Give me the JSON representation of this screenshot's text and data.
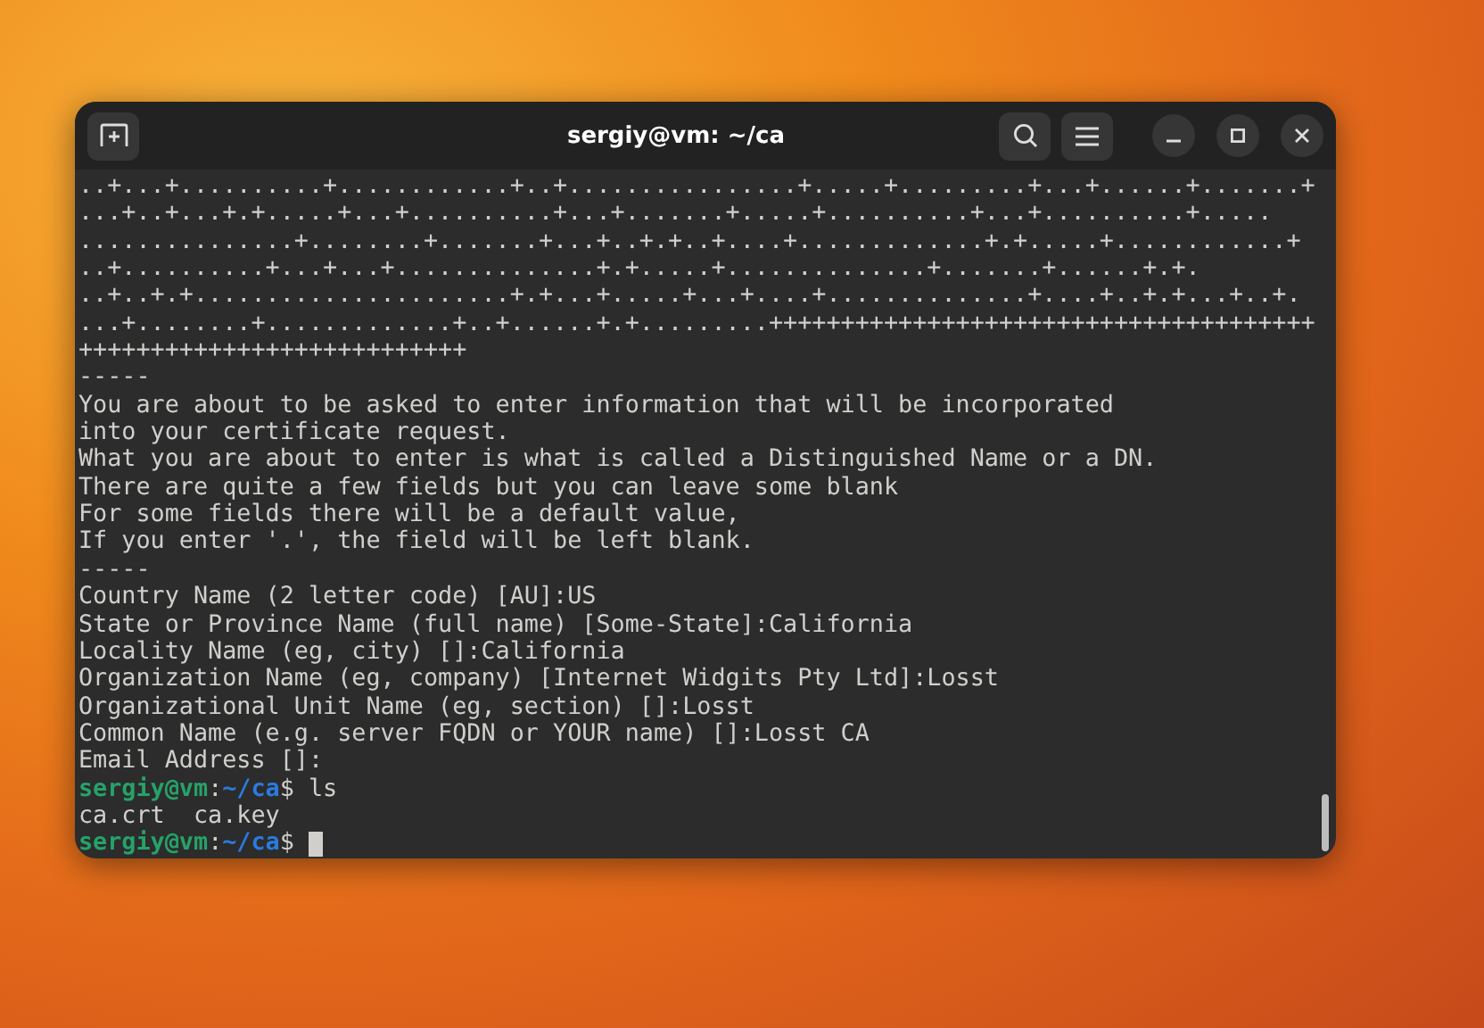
{
  "window": {
    "title": "sergiy@vm: ~/ca"
  },
  "terminal": {
    "lines": [
      {
        "kind": "plain",
        "text": "..+...+..........+............+..+................+.....+.........+...+......+.......+"
      },
      {
        "kind": "plain",
        "text": "...+..+...+.+.....+...+..........+...+.......+.....+..........+...+..........+....."
      },
      {
        "kind": "plain",
        "text": "...............+........+.......+...+..+.+..+....+.............+.+.....+............+"
      },
      {
        "kind": "plain",
        "text": "..+..........+...+...+..............+.+.....+..............+.......+......+.+."
      },
      {
        "kind": "plain",
        "text": "..+..+.+......................+.+...+.....+...+....+..............+....+..+.+...+..+."
      },
      {
        "kind": "plain",
        "text": "...+........+.............+..+......+.+.........++++++++++++++++++++++++++++++++++++++"
      },
      {
        "kind": "plain",
        "text": "+++++++++++++++++++++++++++"
      },
      {
        "kind": "plain",
        "text": "-----"
      },
      {
        "kind": "plain",
        "text": "You are about to be asked to enter information that will be incorporated"
      },
      {
        "kind": "plain",
        "text": "into your certificate request."
      },
      {
        "kind": "plain",
        "text": "What you are about to enter is what is called a Distinguished Name or a DN."
      },
      {
        "kind": "plain",
        "text": "There are quite a few fields but you can leave some blank"
      },
      {
        "kind": "plain",
        "text": "For some fields there will be a default value,"
      },
      {
        "kind": "plain",
        "text": "If you enter '.', the field will be left blank."
      },
      {
        "kind": "plain",
        "text": "-----"
      },
      {
        "kind": "plain",
        "text": "Country Name (2 letter code) [AU]:US"
      },
      {
        "kind": "plain",
        "text": "State or Province Name (full name) [Some-State]:California"
      },
      {
        "kind": "plain",
        "text": "Locality Name (eg, city) []:California"
      },
      {
        "kind": "plain",
        "text": "Organization Name (eg, company) [Internet Widgits Pty Ltd]:Losst"
      },
      {
        "kind": "plain",
        "text": "Organizational Unit Name (eg, section) []:Losst"
      },
      {
        "kind": "plain",
        "text": "Common Name (e.g. server FQDN or YOUR name) []:Losst CA"
      },
      {
        "kind": "plain",
        "text": "Email Address []:"
      },
      {
        "kind": "prompt",
        "user": "sergiy@vm",
        "separator": ":",
        "path": "~/ca",
        "symbol": "$",
        "command": "ls"
      },
      {
        "kind": "plain",
        "text": "ca.crt  ca.key"
      },
      {
        "kind": "prompt",
        "user": "sergiy@vm",
        "separator": ":",
        "path": "~/ca",
        "symbol": "$",
        "cursor": true
      }
    ]
  }
}
